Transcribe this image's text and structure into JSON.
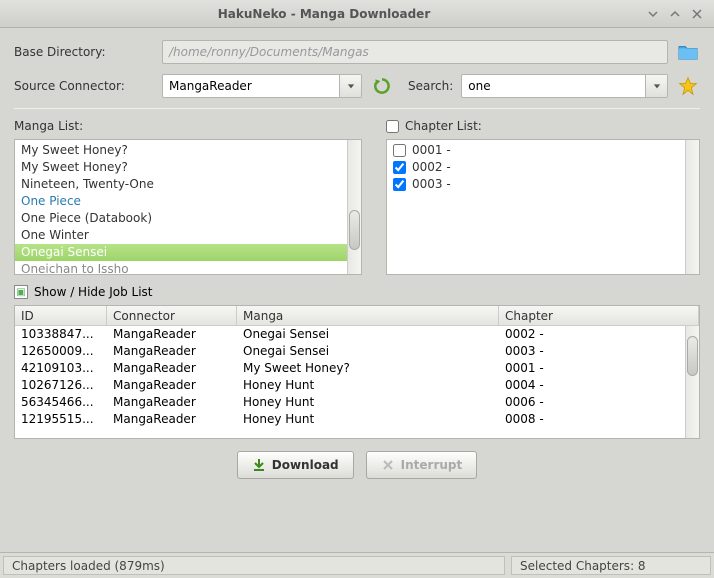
{
  "window": {
    "title": "HakuNeko - Manga Downloader"
  },
  "base": {
    "label": "Base Directory:",
    "path": "/home/ronny/Documents/Mangas"
  },
  "source": {
    "label": "Source Connector:",
    "value": "MangaReader"
  },
  "search": {
    "label": "Search:",
    "value": "one"
  },
  "mangaList": {
    "label": "Manga List:",
    "items": [
      {
        "text": "My Sweet Honey?",
        "style": ""
      },
      {
        "text": "My Sweet Honey?",
        "style": ""
      },
      {
        "text": "Nineteen, Twenty-One",
        "style": ""
      },
      {
        "text": "One Piece",
        "style": "link"
      },
      {
        "text": "One Piece (Databook)",
        "style": ""
      },
      {
        "text": "One Winter",
        "style": ""
      },
      {
        "text": "Onegai Sensei",
        "style": "sel"
      },
      {
        "text": "Oneichan to Issho",
        "style": "cut"
      }
    ]
  },
  "chapterList": {
    "label": "Chapter List:",
    "items": [
      {
        "text": "0001 -",
        "checked": false
      },
      {
        "text": "0002 -",
        "checked": true
      },
      {
        "text": "0003 -",
        "checked": true
      }
    ]
  },
  "jobToggle": {
    "label": "Show / Hide Job List"
  },
  "jobTable": {
    "headers": {
      "id": "ID",
      "connector": "Connector",
      "manga": "Manga",
      "chapter": "Chapter"
    },
    "rows": [
      {
        "id": "10338847...",
        "connector": "MangaReader",
        "manga": "Onegai Sensei",
        "chapter": "0002 -"
      },
      {
        "id": "12650009...",
        "connector": "MangaReader",
        "manga": "Onegai Sensei",
        "chapter": "0003 -"
      },
      {
        "id": "42109103...",
        "connector": "MangaReader",
        "manga": "My Sweet Honey?",
        "chapter": "0001 -"
      },
      {
        "id": "10267126...",
        "connector": "MangaReader",
        "manga": "Honey Hunt",
        "chapter": "0004 -"
      },
      {
        "id": "56345466...",
        "connector": "MangaReader",
        "manga": "Honey Hunt",
        "chapter": "0006 -"
      },
      {
        "id": "12195515...",
        "connector": "MangaReader",
        "manga": "Honey Hunt",
        "chapter": "0008 -"
      }
    ]
  },
  "buttons": {
    "download": "Download",
    "interrupt": "Interrupt"
  },
  "status": {
    "left": "Chapters loaded (879ms)",
    "right": "Selected Chapters: 8"
  }
}
